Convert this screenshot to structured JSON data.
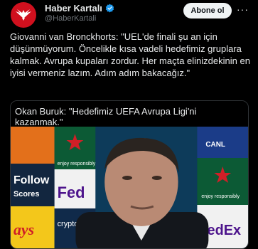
{
  "account": {
    "name": "Haber Kartalı",
    "handle": "@HaberKartali",
    "follow_label": "Abone ol"
  },
  "tweet": {
    "text": "Giovanni van Bronckhorts: \"UEL'de finali şu an için düşünmüyorum. Öncelikle kısa vadeli hedefimiz gruplara kalmak. Avrupa kupaları zordur. Her maçta elinizdekinin en iyisi vermeniz lazım. Adım adım bakacağız.\""
  },
  "media": {
    "caption": "Okan Buruk: \"Hedefimiz UEFA Avrupa Ligi'ni kazanmak.\"",
    "backdrop_texts": [
      "Follow",
      "Scores",
      "Fed",
      "Ex",
      "FedEx",
      "enjoy responsibly",
      "crypto.co",
      "CANL",
      "ays"
    ]
  },
  "colors": {
    "accent_red": "#d0101e",
    "verified_blue": "#1d9bf0",
    "background": "#000000"
  },
  "icons": [
    "eagle-logo-icon",
    "verified-badge-icon",
    "more-options-icon"
  ]
}
